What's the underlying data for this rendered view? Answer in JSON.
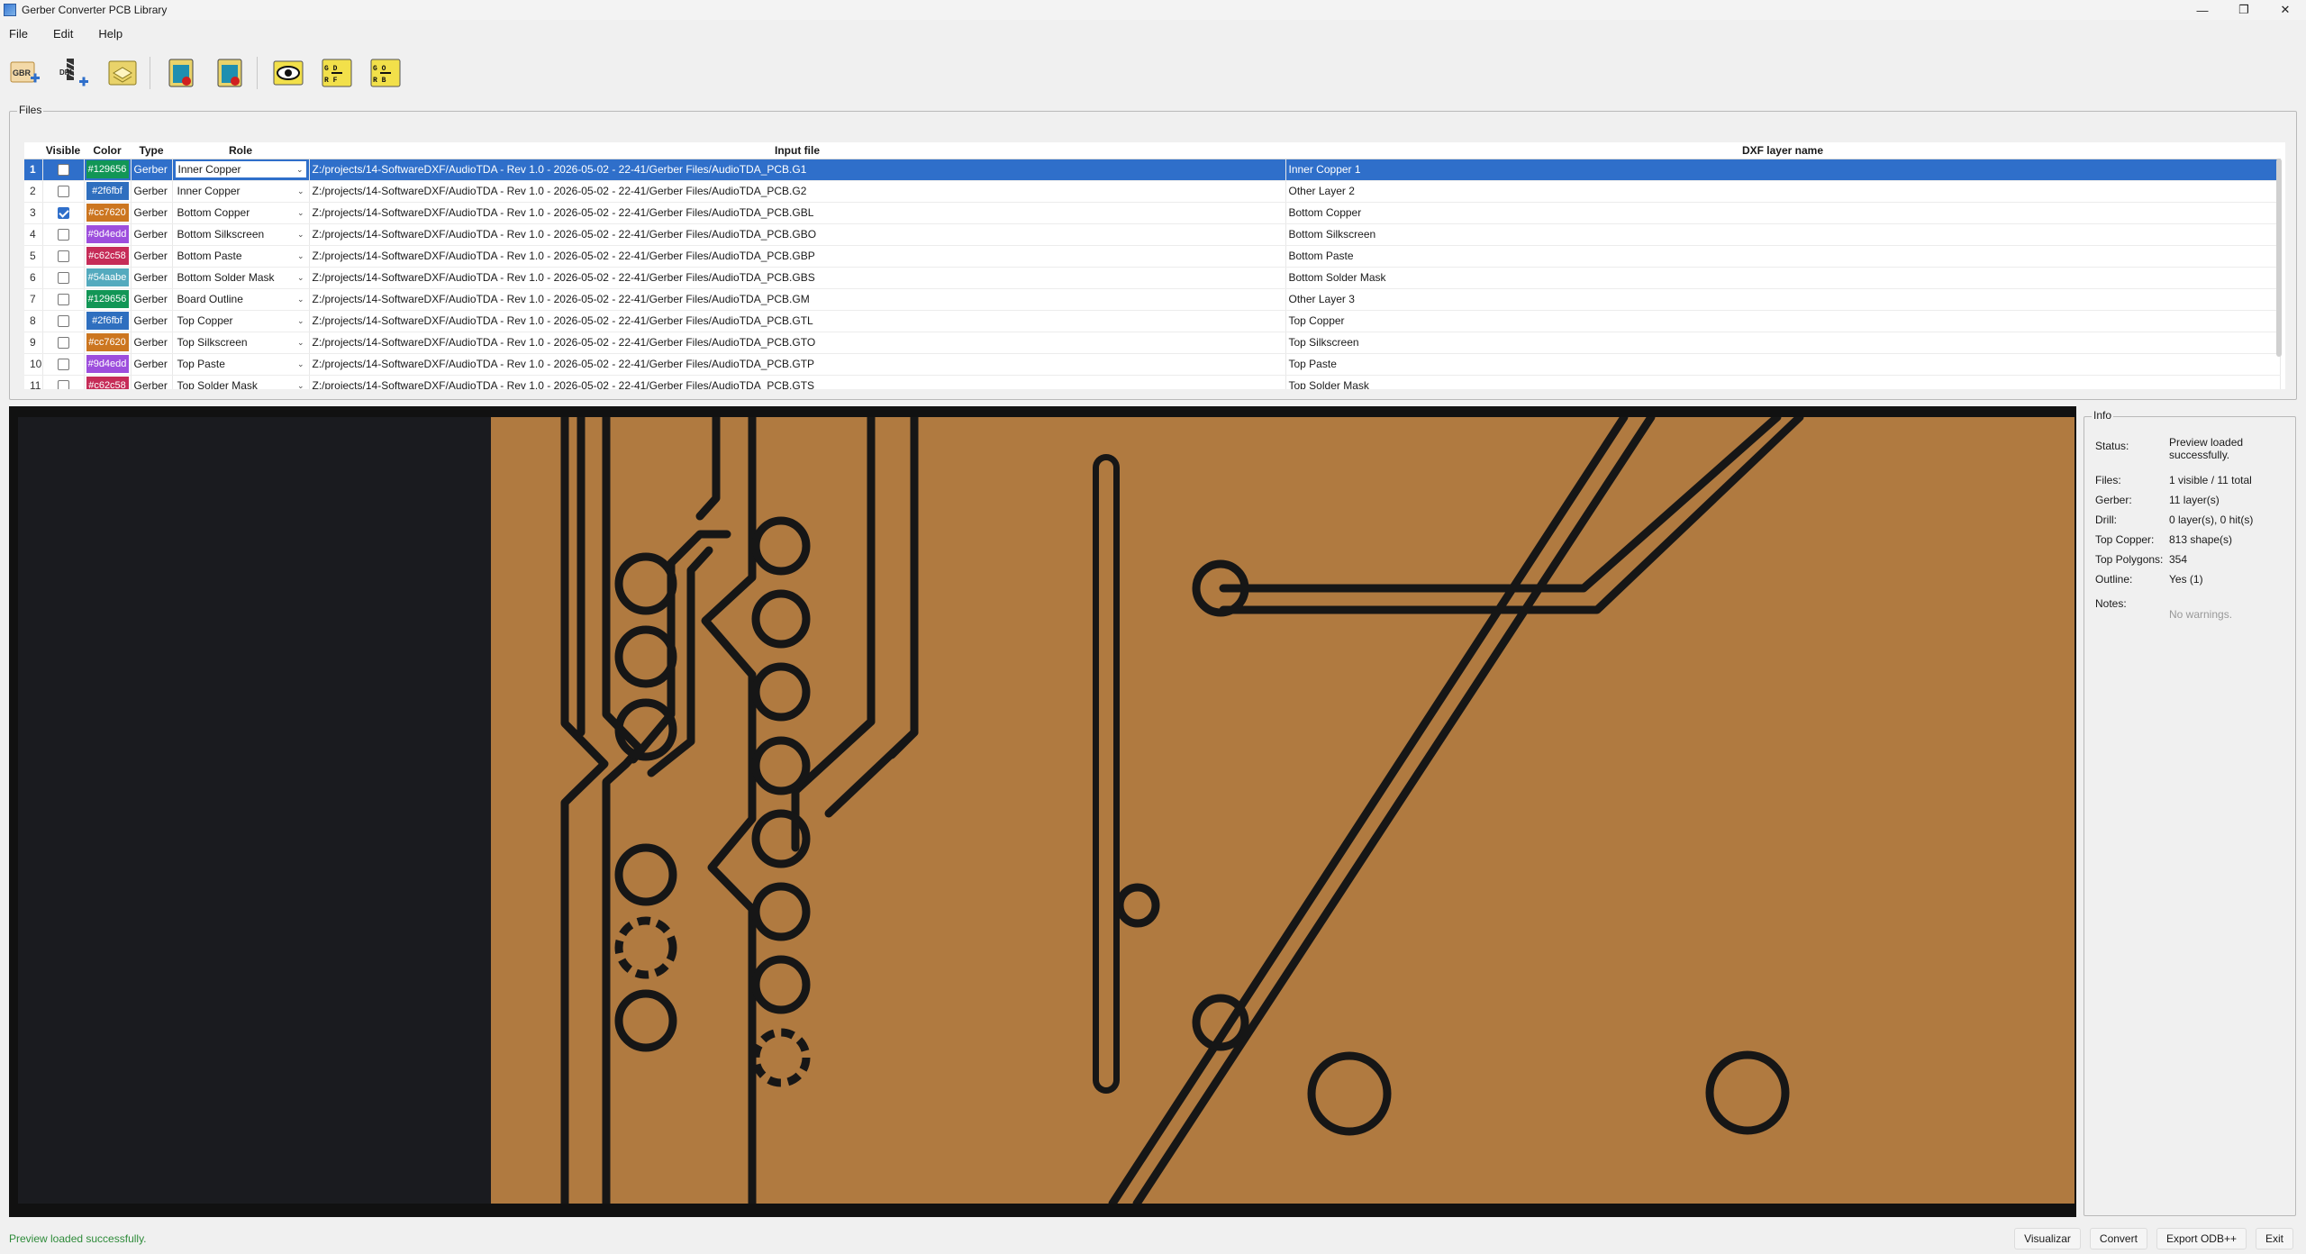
{
  "window": {
    "title": "Gerber Converter PCB Library"
  },
  "menu": [
    "File",
    "Edit",
    "Help"
  ],
  "toolbar_icons": [
    "gbr-add-icon",
    "drill-add-icon",
    "layers-icon",
    "paste-red-icon",
    "paste-red2-icon",
    "eye-icon",
    "convert-dxf-icon",
    "convert-odb-icon"
  ],
  "files": {
    "title": "Files",
    "columns": [
      "Visible",
      "Color",
      "Type",
      "Role",
      "Input file",
      "DXF layer name"
    ],
    "rows": [
      {
        "n": "1",
        "visible": false,
        "color": "#129656",
        "type": "Gerber",
        "role": "Inner Copper",
        "file": "Z:/projects/14-SoftwareDXF/AudioTDA - Rev  1.0 - 2026-05-02 - 22-41/Gerber Files/AudioTDA_PCB.G1",
        "dxf": "Inner Copper 1",
        "selected": true
      },
      {
        "n": "2",
        "visible": false,
        "color": "#2f6fbf",
        "type": "Gerber",
        "role": "Inner Copper",
        "file": "Z:/projects/14-SoftwareDXF/AudioTDA - Rev  1.0 - 2026-05-02 - 22-41/Gerber Files/AudioTDA_PCB.G2",
        "dxf": "Other Layer 2"
      },
      {
        "n": "3",
        "visible": true,
        "color": "#cc7620",
        "type": "Gerber",
        "role": "Bottom Copper",
        "file": "Z:/projects/14-SoftwareDXF/AudioTDA - Rev  1.0 - 2026-05-02 - 22-41/Gerber Files/AudioTDA_PCB.GBL",
        "dxf": "Bottom Copper"
      },
      {
        "n": "4",
        "visible": false,
        "color": "#9d4edd",
        "type": "Gerber",
        "role": "Bottom Silkscreen",
        "file": "Z:/projects/14-SoftwareDXF/AudioTDA - Rev  1.0 - 2026-05-02 - 22-41/Gerber Files/AudioTDA_PCB.GBO",
        "dxf": "Bottom Silkscreen"
      },
      {
        "n": "5",
        "visible": false,
        "color": "#c62c58",
        "type": "Gerber",
        "role": "Bottom Paste",
        "file": "Z:/projects/14-SoftwareDXF/AudioTDA - Rev  1.0 - 2026-05-02 - 22-41/Gerber Files/AudioTDA_PCB.GBP",
        "dxf": "Bottom Paste"
      },
      {
        "n": "6",
        "visible": false,
        "color": "#54aabe",
        "type": "Gerber",
        "role": "Bottom Solder Mask",
        "file": "Z:/projects/14-SoftwareDXF/AudioTDA - Rev  1.0 - 2026-05-02 - 22-41/Gerber Files/AudioTDA_PCB.GBS",
        "dxf": "Bottom Solder Mask"
      },
      {
        "n": "7",
        "visible": false,
        "color": "#129656",
        "type": "Gerber",
        "role": "Board Outline",
        "file": "Z:/projects/14-SoftwareDXF/AudioTDA - Rev  1.0 - 2026-05-02 - 22-41/Gerber Files/AudioTDA_PCB.GM",
        "dxf": "Other Layer 3"
      },
      {
        "n": "8",
        "visible": false,
        "color": "#2f6fbf",
        "type": "Gerber",
        "role": "Top Copper",
        "file": "Z:/projects/14-SoftwareDXF/AudioTDA - Rev  1.0 - 2026-05-02 - 22-41/Gerber Files/AudioTDA_PCB.GTL",
        "dxf": "Top Copper"
      },
      {
        "n": "9",
        "visible": false,
        "color": "#cc7620",
        "type": "Gerber",
        "role": "Top Silkscreen",
        "file": "Z:/projects/14-SoftwareDXF/AudioTDA - Rev  1.0 - 2026-05-02 - 22-41/Gerber Files/AudioTDA_PCB.GTO",
        "dxf": "Top Silkscreen"
      },
      {
        "n": "10",
        "visible": false,
        "color": "#9d4edd",
        "type": "Gerber",
        "role": "Top Paste",
        "file": "Z:/projects/14-SoftwareDXF/AudioTDA - Rev  1.0 - 2026-05-02 - 22-41/Gerber Files/AudioTDA_PCB.GTP",
        "dxf": "Top Paste"
      },
      {
        "n": "11",
        "visible": false,
        "color": "#c62c58",
        "type": "Gerber",
        "role": "Top Solder Mask",
        "file": "Z:/projects/14-SoftwareDXF/AudioTDA - Rev  1.0 - 2026-05-02 - 22-41/Gerber Files/AudioTDA_PCB.GTS",
        "dxf": "Top Solder Mask"
      }
    ]
  },
  "info": {
    "title": "Info",
    "status_label": "Status:",
    "status_value": "Preview loaded successfully.",
    "files_label": "Files:",
    "files_value": "1 visible / 11 total",
    "gerber_label": "Gerber:",
    "gerber_value": "11 layer(s)",
    "drill_label": "Drill:",
    "drill_value": "0 layer(s), 0 hit(s)",
    "topcopper_label": "Top Copper:",
    "topcopper_value": "813 shape(s)",
    "toppoly_label": "Top Polygons:",
    "toppoly_value": "354",
    "outline_label": "Outline:",
    "outline_value": "Yes (1)",
    "notes_label": "Notes:",
    "notes_value": "No warnings."
  },
  "statusbar": {
    "message": "Preview loaded successfully.",
    "buttons": [
      "Visualizar",
      "Convert",
      "Export ODB++",
      "Exit"
    ]
  },
  "colors": {
    "copper": "#b07a40",
    "selection": "#2f6fca",
    "status_ok": "#2e8b3a"
  }
}
